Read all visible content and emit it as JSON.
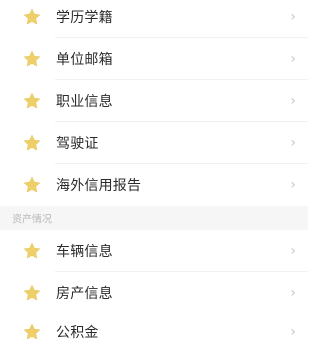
{
  "group1": {
    "items": [
      {
        "label": "学历学籍",
        "icon": "star-icon"
      },
      {
        "label": "单位邮箱",
        "icon": "star-icon"
      },
      {
        "label": "职业信息",
        "icon": "star-icon"
      },
      {
        "label": "驾驶证",
        "icon": "star-icon"
      },
      {
        "label": "海外信用报告",
        "icon": "star-icon"
      }
    ]
  },
  "section": {
    "title": "资产情况"
  },
  "group2": {
    "items": [
      {
        "label": "车辆信息",
        "icon": "star-icon"
      },
      {
        "label": "房产信息",
        "icon": "star-icon"
      },
      {
        "label": "公积金",
        "icon": "star-icon"
      }
    ]
  },
  "chevron": "›",
  "colors": {
    "star": "#efcf6a",
    "text": "#2b2b2b",
    "chevron": "#c8c8c8",
    "section_bg": "#f6f6f6",
    "section_text": "#b8b8b8"
  }
}
